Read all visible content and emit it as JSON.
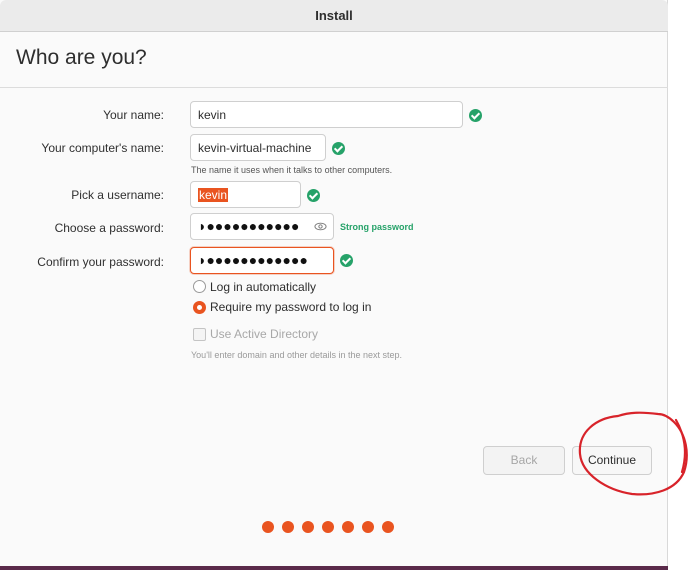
{
  "window": {
    "title": "Install"
  },
  "page": {
    "heading": "Who are you?"
  },
  "form": {
    "name": {
      "label": "Your name:",
      "value": "kevin"
    },
    "computer": {
      "label": "Your computer's name:",
      "value": "kevin-virtual-machine",
      "hint": "The name it uses when it talks to other computers."
    },
    "username": {
      "label": "Pick a username:",
      "value": "kevin"
    },
    "password": {
      "label": "Choose a password:",
      "masked": "◗●●●●●●●●●●●",
      "strength": "Strong password"
    },
    "confirm": {
      "label": "Confirm your password:",
      "masked": "◗●●●●●●●●●●●●"
    }
  },
  "options": {
    "login_auto": "Log in automatically",
    "require_password": "Require my password to log in",
    "selected": "require_password",
    "active_directory": "Use Active Directory",
    "active_directory_hint": "You'll enter domain and other details in the next step."
  },
  "buttons": {
    "back": "Back",
    "continue": "Continue"
  },
  "progress": {
    "steps": 7
  },
  "colors": {
    "accent": "#e95420",
    "success": "#26a269",
    "annotation": "#d8232a"
  }
}
